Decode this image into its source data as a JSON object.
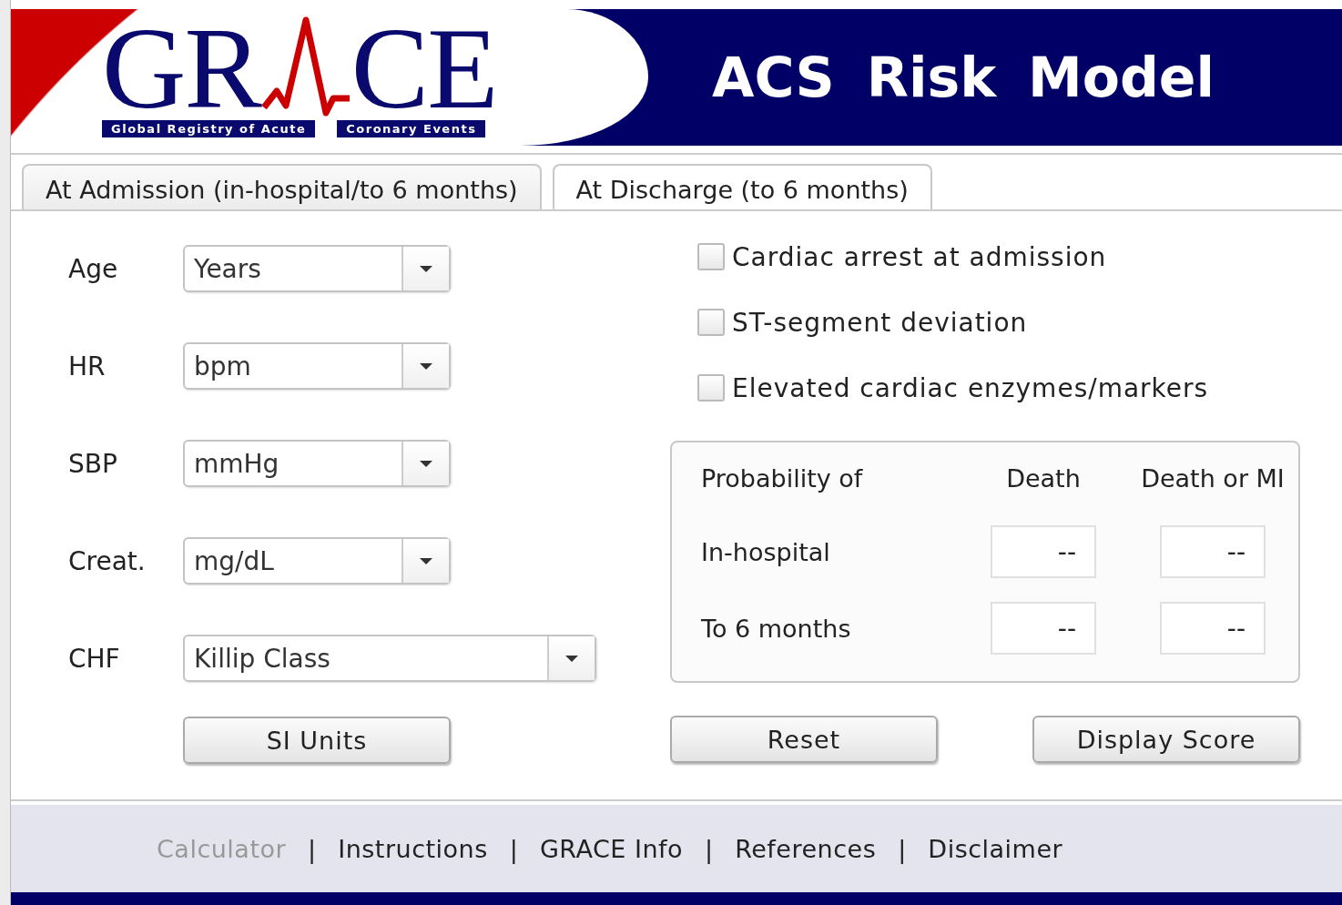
{
  "header": {
    "logo": {
      "letters_left": "GR",
      "letters_right": "CE",
      "tagline_left": "Global Registry of Acute",
      "tagline_right": "Coronary Events"
    },
    "title": "ACS Risk Model"
  },
  "tabs": [
    {
      "label": "At Admission (in-hospital/to 6 months)",
      "selected": true
    },
    {
      "label": "At Discharge (to 6 months)",
      "selected": false
    }
  ],
  "fields": [
    {
      "label": "Age",
      "placeholder": "Years",
      "kind": "short"
    },
    {
      "label": "HR",
      "placeholder": "bpm",
      "kind": "short"
    },
    {
      "label": "SBP",
      "placeholder": "mmHg",
      "kind": "short"
    },
    {
      "label": "Creat.",
      "placeholder": "mg/dL",
      "kind": "short"
    },
    {
      "label": "CHF",
      "placeholder": "Killip Class",
      "kind": "long"
    }
  ],
  "units_button": "SI Units",
  "checkboxes": [
    {
      "label": "Cardiac arrest at admission",
      "checked": false
    },
    {
      "label": "ST-segment deviation",
      "checked": false
    },
    {
      "label": "Elevated cardiac enzymes/markers",
      "checked": false
    }
  ],
  "probability": {
    "heading": "Probability of",
    "columns": [
      "Death",
      "Death or MI"
    ],
    "rows": [
      {
        "label": "In-hospital",
        "values": [
          "--",
          "--"
        ]
      },
      {
        "label": "To 6 months",
        "values": [
          "--",
          "--"
        ]
      }
    ]
  },
  "buttons": [
    "Reset",
    "Display Score"
  ],
  "footer": {
    "links": [
      {
        "label": "Calculator",
        "selected": true
      },
      {
        "label": "Instructions",
        "selected": false
      },
      {
        "label": "GRACE Info",
        "selected": false
      },
      {
        "label": "References",
        "selected": false
      },
      {
        "label": "Disclaimer",
        "selected": false
      }
    ],
    "separators": [
      "|",
      "|",
      "|",
      "|"
    ]
  }
}
